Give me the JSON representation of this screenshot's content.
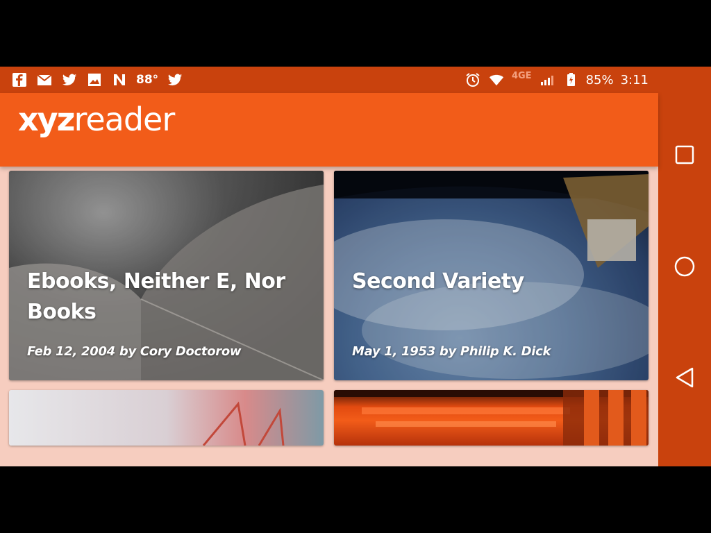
{
  "status_bar": {
    "left_icons": [
      "facebook-icon",
      "gmail-icon",
      "twitter-icon",
      "image-icon",
      "news-icon"
    ],
    "temperature": "88°",
    "network_type": "4GE",
    "battery_percent": "85%",
    "time": "3:11"
  },
  "toolbar": {
    "logo_bold": "xyz",
    "logo_regular": "reader"
  },
  "articles": [
    {
      "title": "Ebooks, Neither E, Nor Books",
      "meta": "Feb 12, 2004 by Cory Doctorow"
    },
    {
      "title": "Second Variety",
      "meta": "May 1, 1953 by Philip K. Dick"
    }
  ],
  "nav_bar": {
    "icons": [
      "recent-apps-icon",
      "home-icon",
      "back-icon"
    ]
  },
  "colors": {
    "status_bar": "#c9420d",
    "toolbar": "#f25c19",
    "content_background": "#f6cdbf",
    "nav_bar": "#c9420d"
  }
}
